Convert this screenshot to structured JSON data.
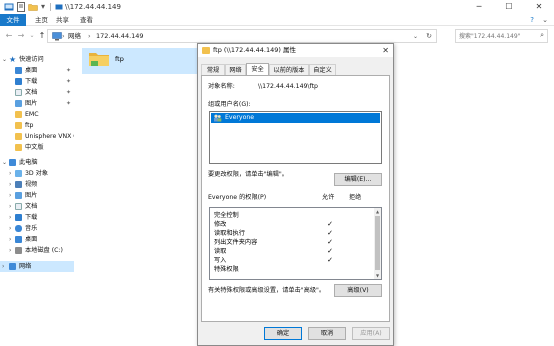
{
  "explorer": {
    "title_path": "\\\\172.44.44.149",
    "ribbon": {
      "file_tab": "文件",
      "tabs": [
        "主页",
        "共享",
        "查看"
      ]
    },
    "address": {
      "crumbs": [
        "网络",
        "172.44.44.149"
      ],
      "search_placeholder": "搜索\"172.44.44.149\""
    },
    "nav": {
      "quick_access": "快速访问",
      "quick_items": [
        "桌面",
        "下载",
        "文档",
        "图片",
        "EMC",
        "ftp",
        "Unisphere VNX Cl",
        "中文版"
      ],
      "this_pc": "此电脑",
      "pc_items": [
        "3D 对象",
        "视频",
        "图片",
        "文档",
        "下载",
        "音乐",
        "桌面",
        "本地磁盘 (C:)"
      ],
      "network": "网络"
    },
    "content": {
      "items": [
        {
          "name": "ftp"
        }
      ]
    }
  },
  "dialog": {
    "title": "ftp (\\\\172.44.44.149) 属性",
    "tabs": [
      "常规",
      "网络",
      "安全",
      "以前的版本",
      "自定义"
    ],
    "active_tab": "安全",
    "object_name_label": "对象名称:",
    "object_name_value": "\\\\172.44.44.149\\ftp",
    "group_label": "组或用户名(G):",
    "users": [
      "Everyone"
    ],
    "edit_hint": "要更改权限，请单击\"编辑\"。",
    "edit_button": "编辑(E)...",
    "perm_header": "Everyone 的权限(P)",
    "allow_header": "允许",
    "deny_header": "拒绝",
    "permissions": [
      {
        "name": "完全控制",
        "allow": "",
        "deny": ""
      },
      {
        "name": "修改",
        "allow": "✓",
        "deny": ""
      },
      {
        "name": "读取和执行",
        "allow": "✓",
        "deny": ""
      },
      {
        "name": "列出文件夹内容",
        "allow": "✓",
        "deny": ""
      },
      {
        "name": "读取",
        "allow": "✓",
        "deny": ""
      },
      {
        "name": "写入",
        "allow": "✓",
        "deny": ""
      },
      {
        "name": "特殊权限",
        "allow": "",
        "deny": ""
      }
    ],
    "advanced_hint": "有关特殊权限或高级设置，请单击\"高级\"。",
    "advanced_button": "高级(V)",
    "ok_button": "确定",
    "cancel_button": "取消",
    "apply_button": "应用(A)"
  },
  "colors": {
    "accent": "#0078d7",
    "file_tab": "#1979ca",
    "selection": "#cce8ff",
    "folder": "#f2c14e"
  }
}
